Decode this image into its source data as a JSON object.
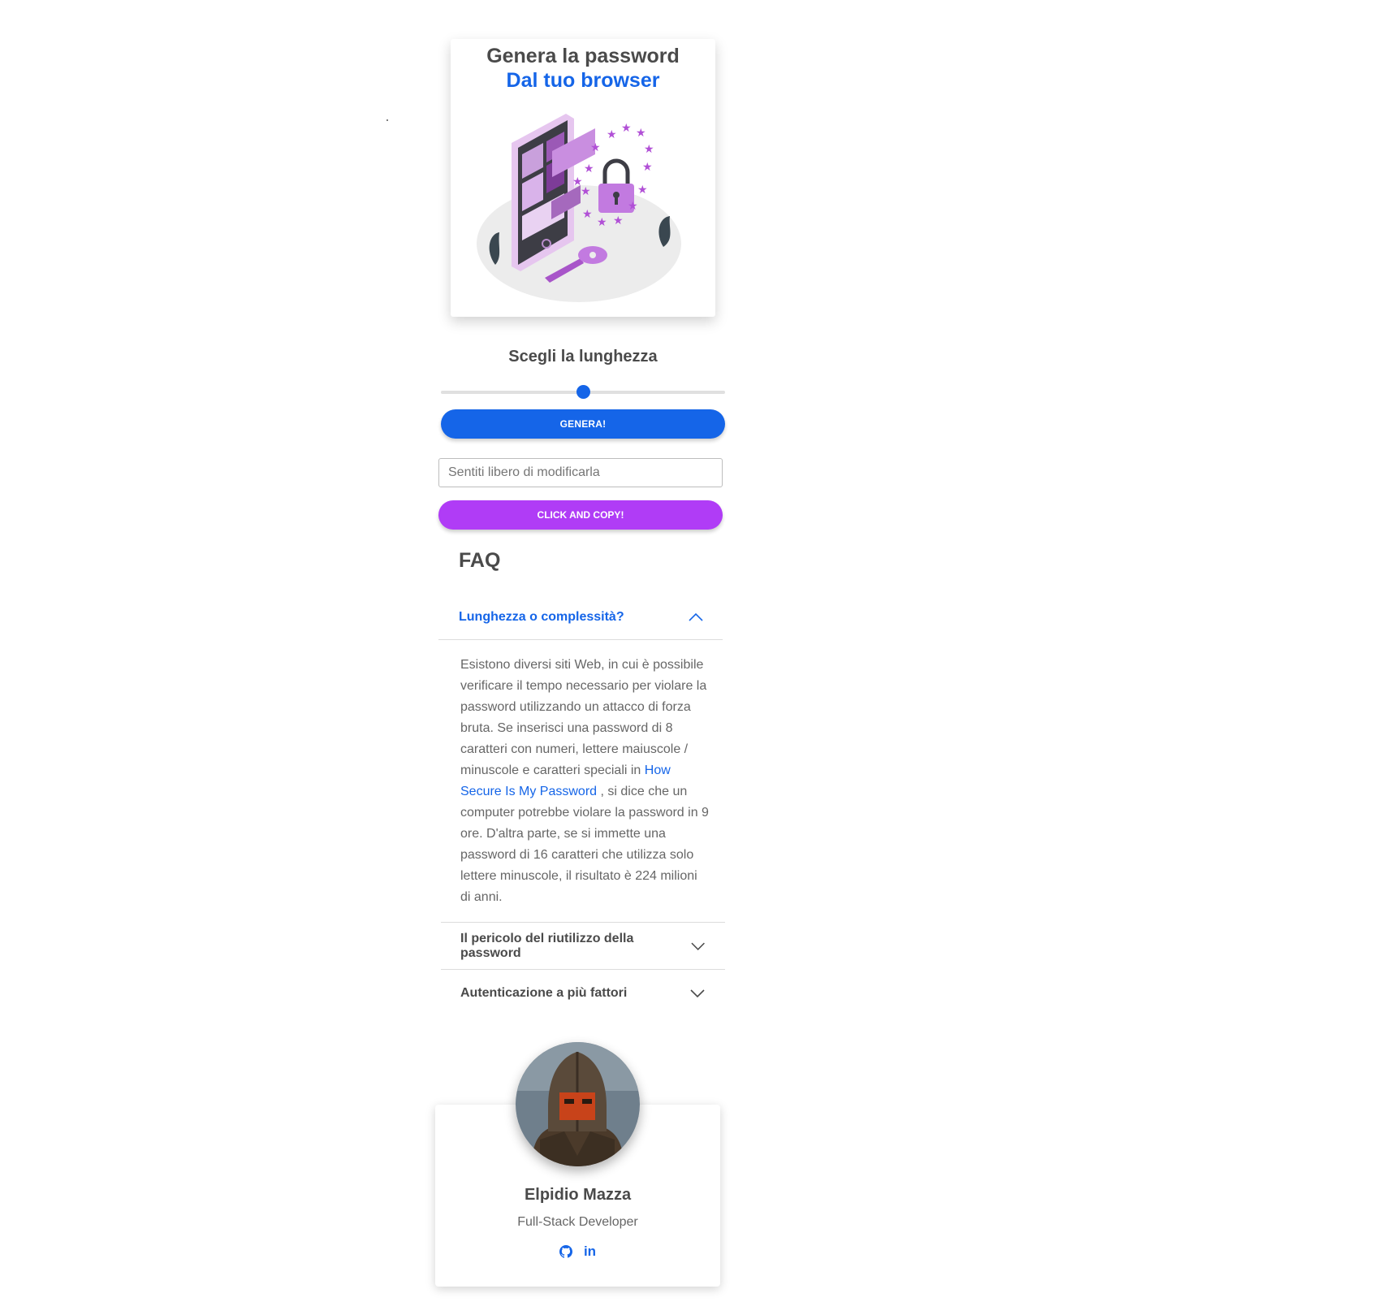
{
  "hero": {
    "title": "Genera la password",
    "subtitle": "Dal tuo browser",
    "illustration": "phone-lock-key-illustration"
  },
  "generator": {
    "length_title": "Scegli la lunghezza",
    "slider_value_fraction": 0.5,
    "generate_label": "GENERA!",
    "password_placeholder": "Sentiti libero di modificarla",
    "password_value": "",
    "copy_label": "CLICK AND COPY!"
  },
  "faq": {
    "title": "FAQ",
    "items": [
      {
        "question": "Lunghezza o complessità?",
        "expanded": true,
        "answer_part1": "Esistono diversi siti Web, in cui è possibile verificare il tempo necessario per violare la password utilizzando un attacco di forza bruta. Se inserisci una password di 8 caratteri con numeri, lettere maiuscole / minuscole e caratteri speciali in",
        "answer_link": "How Secure Is My Password",
        "answer_part2": ", si dice che un computer potrebbe violare la password in 9 ore. D'altra parte, se si immette una password di 16 caratteri che utilizza solo lettere minuscole, il risultato è 224 milioni di anni."
      },
      {
        "question": "Il pericolo del riutilizzo della password",
        "expanded": false
      },
      {
        "question": "Autenticazione a più fattori",
        "expanded": false
      }
    ]
  },
  "profile": {
    "name": "Elpidio Mazza",
    "role": "Full-Stack Developer",
    "avatar": "knight-helmet-avatar",
    "social": [
      "github-icon",
      "linkedin-icon"
    ]
  },
  "colors": {
    "primary": "#1565e8",
    "accent": "#b03cf6",
    "text": "#4a4a4a"
  }
}
